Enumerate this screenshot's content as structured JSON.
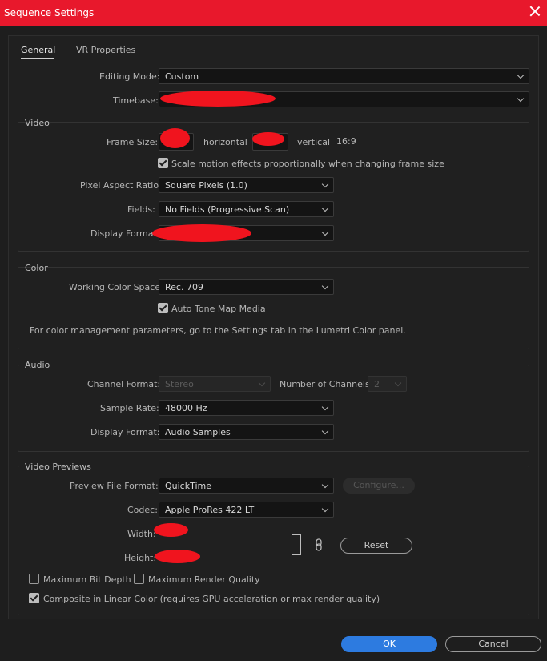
{
  "window": {
    "title": "Sequence Settings"
  },
  "tabs": [
    {
      "label": "General",
      "active": true
    },
    {
      "label": "VR Properties",
      "active": false
    }
  ],
  "general": {
    "editing_mode_label": "Editing Mode:",
    "editing_mode_value": "Custom",
    "timebase_label": "Timebase:"
  },
  "video": {
    "title": "Video",
    "frame_size_label": "Frame Size:",
    "horizontal_label": "horizontal",
    "vertical_label": "vertical",
    "aspect_label": "16:9",
    "scale_motion_label": "Scale motion effects proportionally when changing frame size",
    "scale_motion_checked": true,
    "pixel_aspect_label": "Pixel Aspect Ratio:",
    "pixel_aspect_value": "Square Pixels (1.0)",
    "fields_label": "Fields:",
    "fields_value": "No Fields (Progressive Scan)",
    "display_format_label": "Display Format:"
  },
  "color": {
    "title": "Color",
    "working_space_label": "Working Color Space:",
    "working_space_value": "Rec. 709",
    "auto_tone_label": "Auto Tone Map Media",
    "auto_tone_checked": true,
    "info_text": "For color management parameters, go to the Settings tab in the Lumetri Color panel."
  },
  "audio": {
    "title": "Audio",
    "channel_format_label": "Channel Format:",
    "channel_format_value": "Stereo",
    "num_channels_label": "Number of Channels:",
    "num_channels_value": "2",
    "sample_rate_label": "Sample Rate:",
    "sample_rate_value": "48000 Hz",
    "display_format_label": "Display Format:",
    "display_format_value": "Audio Samples"
  },
  "previews": {
    "title": "Video Previews",
    "file_format_label": "Preview File Format:",
    "file_format_value": "QuickTime",
    "configure_label": "Configure...",
    "codec_label": "Codec:",
    "codec_value": "Apple ProRes 422 LT",
    "width_label": "Width:",
    "height_label": "Height:",
    "reset_label": "Reset",
    "max_bit_depth_label": "Maximum Bit Depth",
    "max_bit_depth_checked": false,
    "max_render_quality_label": "Maximum Render Quality",
    "max_render_quality_checked": false,
    "composite_linear_label": "Composite in Linear Color (requires GPU acceleration or max render quality)",
    "composite_linear_checked": true
  },
  "footer": {
    "ok_label": "OK",
    "cancel_label": "Cancel"
  },
  "colors": {
    "titlebar": "#e8182c",
    "accent": "#2d7be0",
    "redaction": "#f0141e"
  }
}
